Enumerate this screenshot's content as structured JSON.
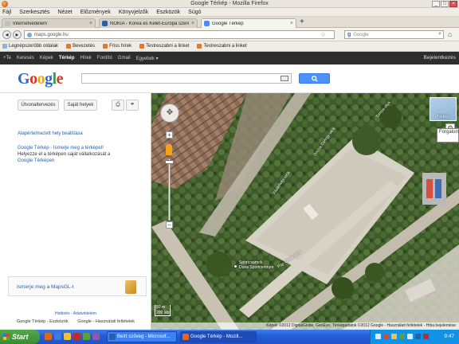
{
  "window": {
    "title": "Google Térkép - Mozilla Firefox"
  },
  "menu": [
    "Fájl",
    "Szerkesztés",
    "Nézet",
    "Előzmények",
    "Könyvjelzők",
    "Eszközök",
    "Súgó"
  ],
  "tabs": [
    {
      "label": "Internetvédelem",
      "color": "#c0c0c0"
    },
    {
      "label": "NOKIA - Korea és Kelet-Európa szerepe...",
      "color": "#2b5ea7"
    },
    {
      "label": "Google Térkép",
      "color": "#4a8af4",
      "active": true
    }
  ],
  "nav": {
    "url": "maps.google.hu",
    "search_placeholder": "Google"
  },
  "bookmarks": [
    {
      "label": "Legnépszerűbb oldalak",
      "color": "#8fb2d9"
    },
    {
      "label": "Bevezetés",
      "color": "#e07a2d"
    },
    {
      "label": "Friss hírek",
      "color": "#e07a2d"
    },
    {
      "label": "Testreszabni a linket",
      "color": "#e07a2d"
    },
    {
      "label": "Testreszabni a linket",
      "color": "#e07a2d"
    }
  ],
  "gbar": {
    "items": [
      {
        "label": "+Te"
      },
      {
        "label": "Keresés"
      },
      {
        "label": "Képek"
      },
      {
        "label": "Térkép",
        "active": true
      },
      {
        "label": "Hírek"
      },
      {
        "label": "Fordító"
      },
      {
        "label": "Gmail"
      },
      {
        "label": "Egyebek ▾"
      }
    ],
    "signin": "Bejelentkezés"
  },
  "search": {
    "button": "Keresés"
  },
  "left": {
    "btn_directions": "Útvonaltervezés",
    "btn_places": "Saját helyek",
    "links": [
      "Alapértelmezett hely beállítása",
      "Google Térkép - Ismerje meg a térképet!",
      "Helyezze el a térképen saját vállalkozását a",
      "Google Térképen"
    ],
    "mapsgl": "Ismerje meg a MapsGL-t",
    "foot1": "Hirdetés - Adatvédelem",
    "foot2a": "Google Térkép - Eszközök",
    "foot2b": "Google - Használati feltételek"
  },
  "map": {
    "tmap_label": "Térkép",
    "side_label": "Forgalom",
    "place_label": "Sportcsarnok\nDuna Sportcentrum",
    "streets": [
      "Tompa utca",
      "Dózsa György utca",
      "Vásárhelyi utca",
      "Pap Gyula utca"
    ],
    "scale": "50 m\n200 láb",
    "footer": "Képek ©2012 DigitalGlobe, GeoEye, Térképadatok ©2012 Google - Használati feltételek - Hiba bejelentése"
  },
  "taskbar": {
    "start": "Start",
    "items": [
      {
        "label": "Beírt szöveg - Microsof...",
        "color": "#2b5ea7"
      },
      {
        "label": "Google Térkép - Mozill...",
        "color": "#e0671d",
        "active": true
      }
    ],
    "clock": "9:47"
  }
}
